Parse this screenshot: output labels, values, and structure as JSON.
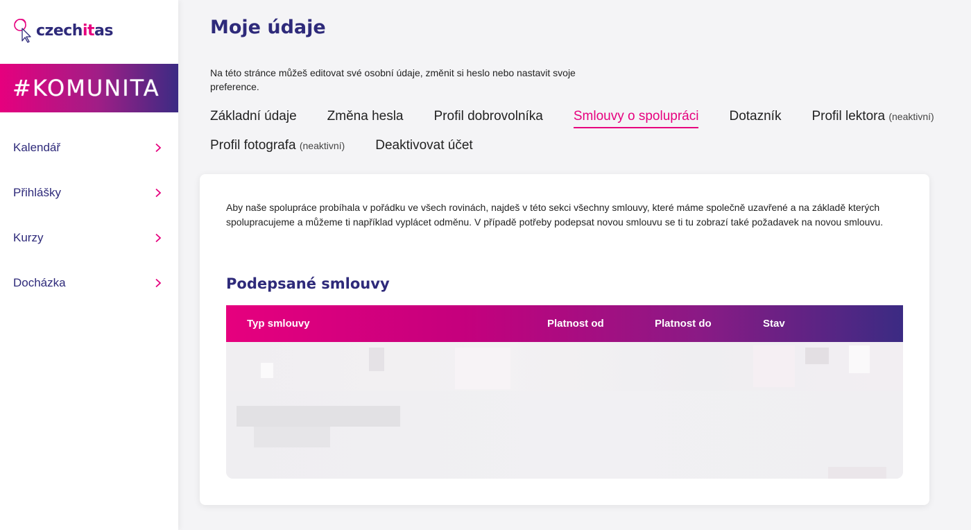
{
  "brand": {
    "name_prefix": "czech",
    "name_accent": "it",
    "name_suffix": "as"
  },
  "banner": {
    "text": "#KOMUNITA"
  },
  "sidebar": {
    "items": [
      {
        "label": "Kalendář"
      },
      {
        "label": "Přihlášky"
      },
      {
        "label": "Kurzy"
      },
      {
        "label": "Docházka"
      }
    ]
  },
  "page": {
    "title": "Moje údaje",
    "intro": "Na této stránce můžeš editovat své osobní údaje, změnit si heslo nebo nastavit svoje preference."
  },
  "tabs": [
    {
      "label": "Základní údaje",
      "suffix": ""
    },
    {
      "label": "Změna hesla",
      "suffix": ""
    },
    {
      "label": "Profil dobrovolníka",
      "suffix": ""
    },
    {
      "label": "Smlouvy o spolupráci",
      "suffix": ""
    },
    {
      "label": "Dotazník",
      "suffix": ""
    },
    {
      "label": "Profil lektora",
      "suffix": "(neaktivní)"
    },
    {
      "label": "Profil fotografa",
      "suffix": "(neaktivní)"
    },
    {
      "label": "Deaktivovat účet",
      "suffix": ""
    }
  ],
  "active_tab_index": 3,
  "contracts": {
    "description": "Aby naše spolupráce probíhala v pořádku ve všech rovinách, najdeš v této sekci všechny smlouvy, které máme společně uzavřené a na základě kterých spolupracujeme a můžeme ti například vyplácet odměnu. V případě potřeby podepsat novou smlouvu se ti tu zobrazí také požadavek na novou smlouvu.",
    "section_title": "Podepsané smlouvy",
    "columns": [
      "Typ smlouvy",
      "Platnost od",
      "Platnost do",
      "Stav"
    ]
  },
  "colors": {
    "accent": "#e6007e",
    "brand_dark": "#2e2a7a",
    "gradient_end": "#3b2b83"
  }
}
